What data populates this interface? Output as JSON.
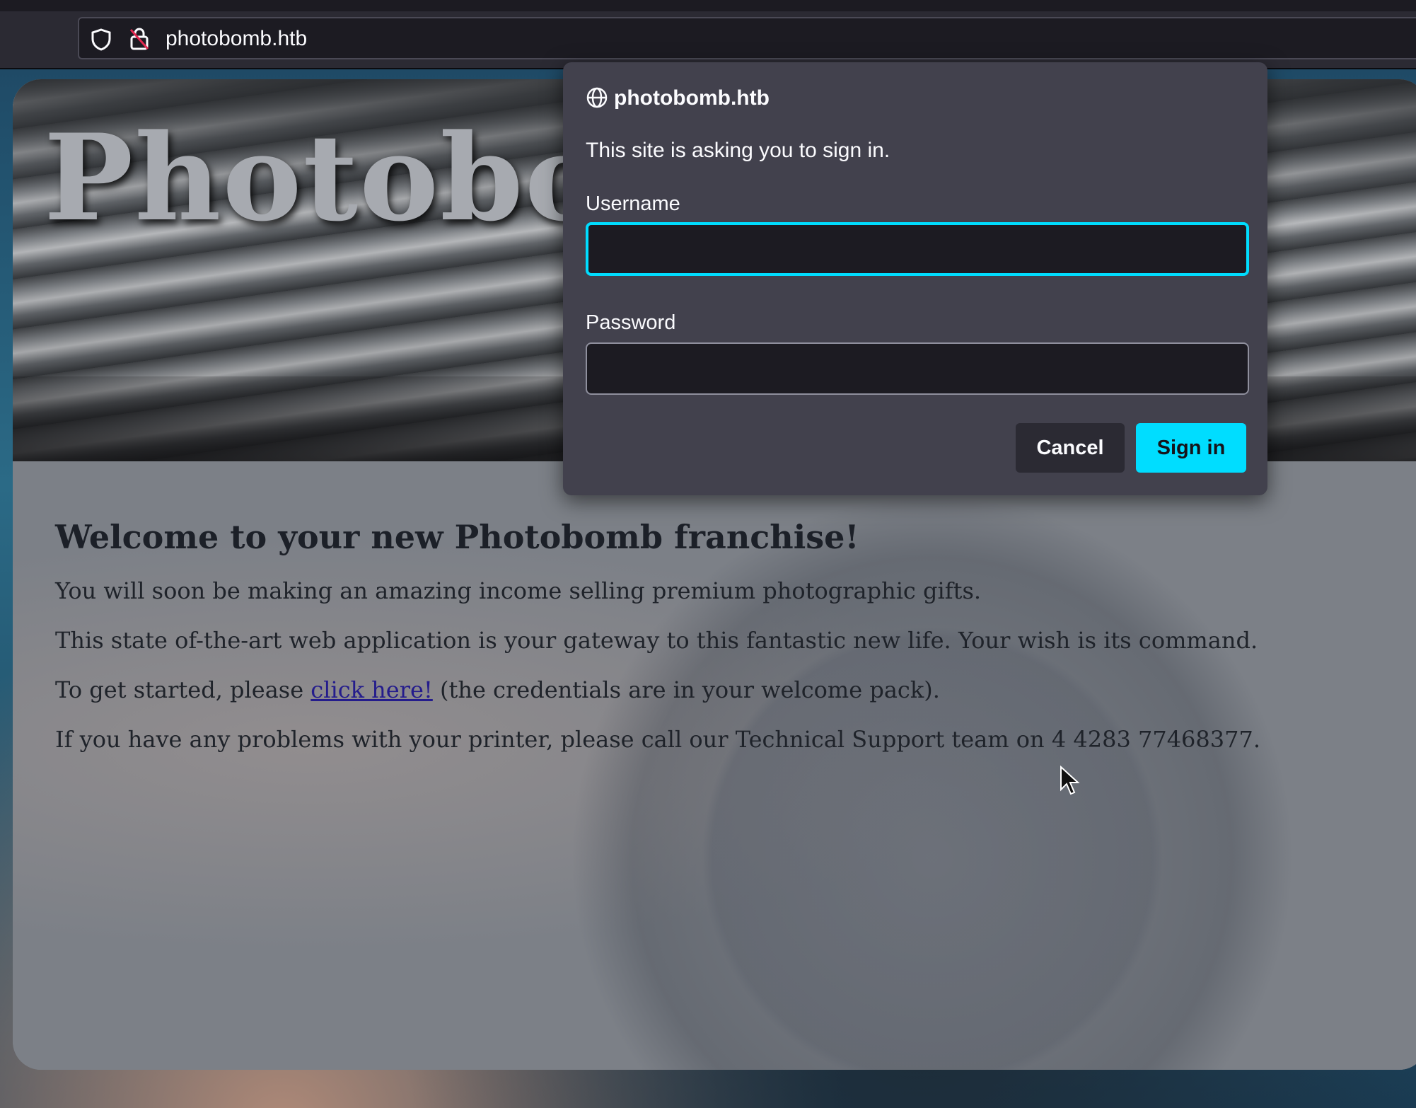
{
  "browser": {
    "url": "photobomb.htb"
  },
  "page": {
    "hero_title": "Photobomb",
    "heading": "Welcome to your new Photobomb franchise!",
    "paragraph_1": "You will soon be making an amazing income selling premium photographic gifts.",
    "paragraph_2": "This state of-the-art web application is your gateway to this fantastic new life. Your wish is its command.",
    "paragraph_3_before": "To get started, please ",
    "paragraph_3_link": "click here!",
    "paragraph_3_after": " (the credentials are in your welcome pack).",
    "paragraph_4": "If you have any problems with your printer, please call our Technical Support team on 4 4283 77468377."
  },
  "dialog": {
    "host": "photobomb.htb",
    "message": "This site is asking you to sign in.",
    "username_label": "Username",
    "username_value": "",
    "password_label": "Password",
    "password_value": "",
    "cancel_label": "Cancel",
    "signin_label": "Sign in"
  },
  "colors": {
    "accent": "#00ddff",
    "dialog_bg": "#42414d",
    "link": "#241c8c"
  },
  "icons": {
    "shield": "shield-icon",
    "lock": "insecure-lock-icon",
    "globe": "globe-icon",
    "cursor": "mouse-pointer-icon"
  }
}
